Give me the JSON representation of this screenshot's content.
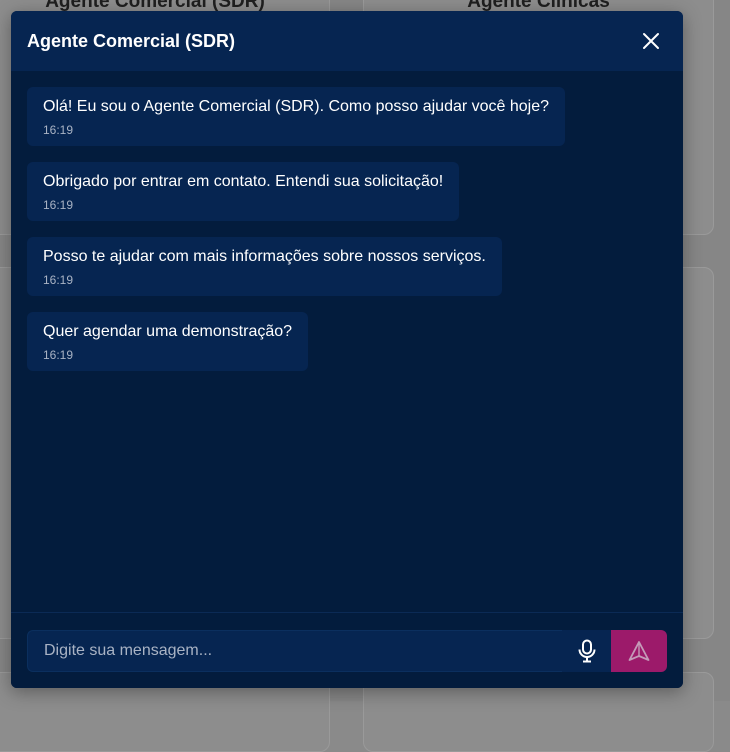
{
  "background": {
    "card_titles": [
      "Agente Comercial (SDR)",
      "Agente Clínicas"
    ]
  },
  "modal": {
    "title": "Agente Comercial (SDR)",
    "close_icon": "close-icon"
  },
  "messages": [
    {
      "text": "Olá! Eu sou o Agente Comercial (SDR). Como posso ajudar você hoje?",
      "time": "16:19"
    },
    {
      "text": "Obrigado por entrar em contato. Entendi sua solicitação!",
      "time": "16:19"
    },
    {
      "text": "Posso te ajudar com mais informações sobre nossos serviços.",
      "time": "16:19"
    },
    {
      "text": "Quer agendar uma demonstração?",
      "time": "16:19"
    }
  ],
  "composer": {
    "placeholder": "Digite sua mensagem...",
    "mic_icon": "microphone-icon",
    "send_icon": "send-icon"
  },
  "colors": {
    "modal_bg": "#031c3d",
    "header_bg": "#062551",
    "send_button": "#9c1a6a"
  }
}
